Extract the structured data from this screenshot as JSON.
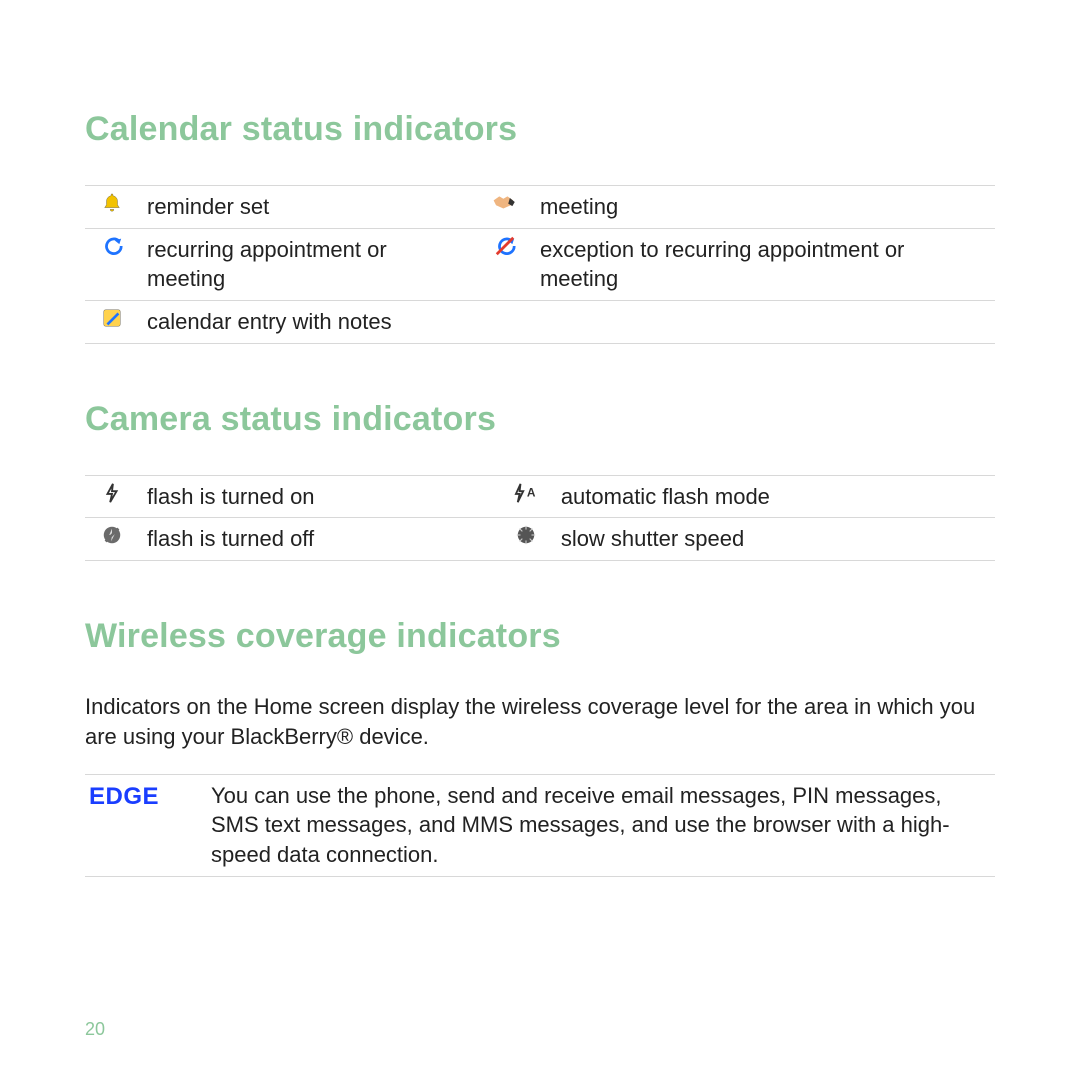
{
  "headings": {
    "calendar": "Calendar status indicators",
    "camera": "Camera status indicators",
    "wireless": "Wireless coverage indicators"
  },
  "calendar": {
    "rows": [
      {
        "left": "reminder set",
        "right": "meeting"
      },
      {
        "left": "recurring appointment or meeting",
        "right": "exception to recurring appointment or meeting"
      },
      {
        "left": "calendar entry with notes",
        "right": ""
      }
    ]
  },
  "camera": {
    "rows": [
      {
        "left": "flash is turned on",
        "right": "automatic flash mode"
      },
      {
        "left": "flash is turned off",
        "right": "slow shutter speed"
      }
    ]
  },
  "wireless": {
    "intro": "Indicators on the Home screen display the wireless coverage level for the area in which you are using your BlackBerry® device.",
    "rows": [
      {
        "label": "EDGE",
        "desc": "You can use the phone, send and receive email messages, PIN messages, SMS text messages, and MMS messages, and use the browser with a high-speed data connection."
      }
    ]
  },
  "page_number": "20"
}
